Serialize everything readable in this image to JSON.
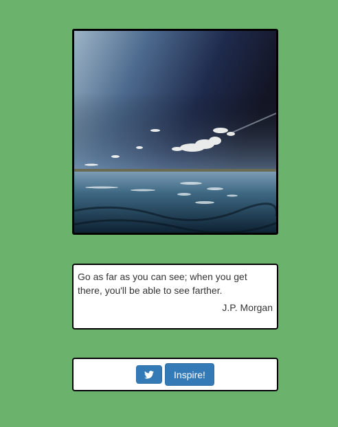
{
  "photo": {
    "alt_subject": "sea-horizon-photo"
  },
  "quote": {
    "text": "Go as far as you can see; when you get there, you'll be able to see farther.",
    "author": "J.P. Morgan"
  },
  "actions": {
    "tweet_icon": "twitter-icon",
    "inspire_label": "Inspire!"
  },
  "colors": {
    "background": "#6bb26d",
    "button": "#337ab7"
  }
}
